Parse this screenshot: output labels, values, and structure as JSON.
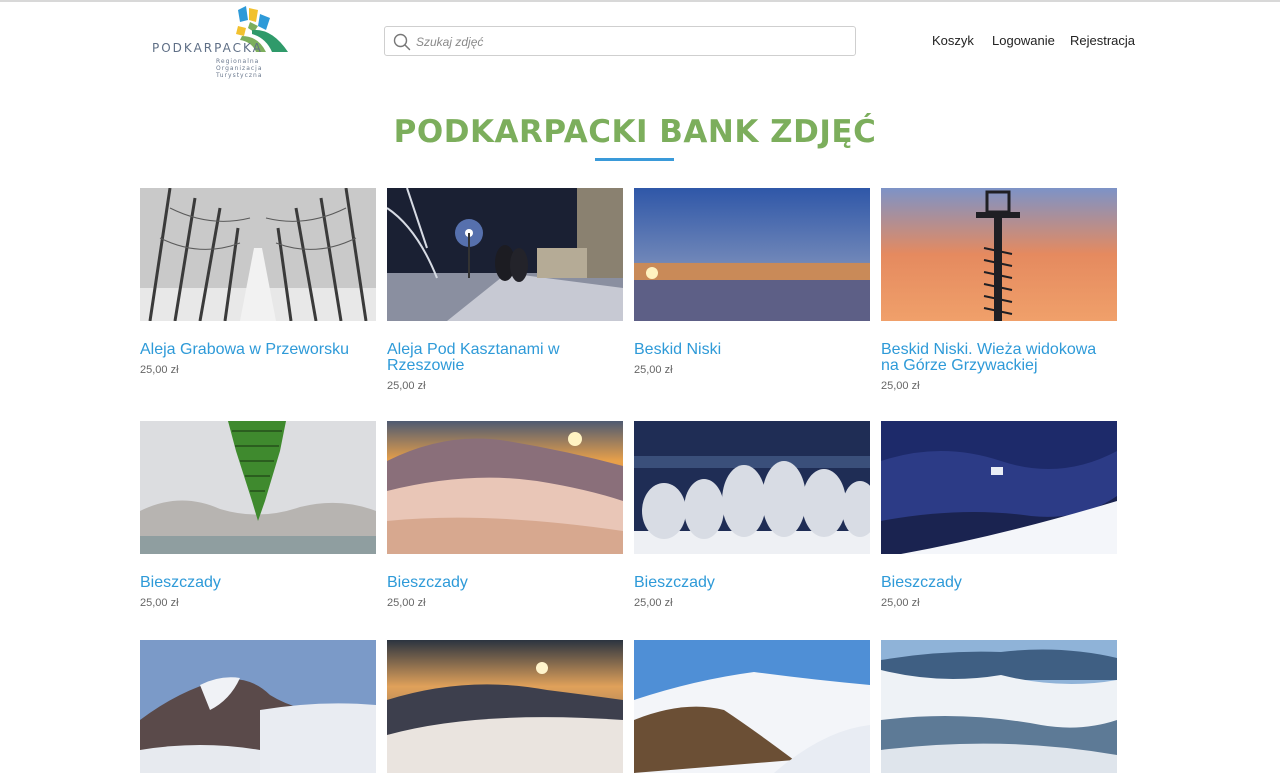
{
  "header": {
    "logo": {
      "wordmark": "PODKARPACKA",
      "subtitle": [
        "Regionalna",
        "Organizacja",
        "Turystyczna"
      ]
    },
    "search": {
      "placeholder": "Szukaj zdjęć",
      "value": ""
    },
    "nav": [
      {
        "label": "Koszyk"
      },
      {
        "label": "Logowanie"
      },
      {
        "label": "Rejestracja"
      }
    ]
  },
  "page": {
    "title": "PODKARPACKI BANK ZDJĘĆ"
  },
  "colors": {
    "title": "#7cae5c",
    "accent": "#3a9ad9",
    "link": "#2e9ad8"
  },
  "products": [
    {
      "title": "Aleja Grabowa w Przeworsku",
      "price": "25,00 zł"
    },
    {
      "title": "Aleja Pod Kasztanami w Rzeszowie",
      "price": "25,00 zł"
    },
    {
      "title": "Beskid Niski",
      "price": "25,00 zł"
    },
    {
      "title": "Beskid Niski. Wieża widokowa na Górze Grzywackiej",
      "price": "25,00 zł"
    },
    {
      "title": "Bieszczady",
      "price": "25,00 zł"
    },
    {
      "title": "Bieszczady",
      "price": "25,00 zł"
    },
    {
      "title": "Bieszczady",
      "price": "25,00 zł"
    },
    {
      "title": "Bieszczady",
      "price": "25,00 zł"
    },
    {
      "title": "",
      "price": ""
    },
    {
      "title": "",
      "price": ""
    },
    {
      "title": "",
      "price": ""
    },
    {
      "title": "",
      "price": ""
    }
  ]
}
